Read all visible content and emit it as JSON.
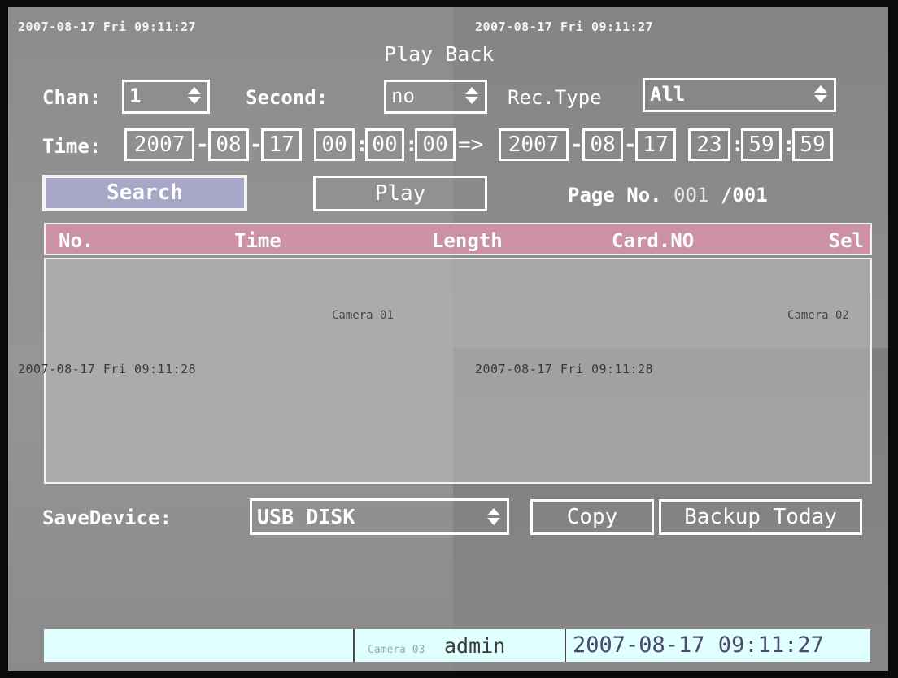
{
  "osd": {
    "ts_top_left": "2007-08-17 Fri 09:11:27",
    "ts_top_right": "2007-08-17 Fri 09:11:27",
    "ts_mid_left": "2007-08-17 Fri 09:11:28",
    "ts_mid_right": "2007-08-17 Fri 09:11:28",
    "camera_01": "Camera 01",
    "camera_02": "Camera 02",
    "camera_03": "Camera 03"
  },
  "title": "Play Back",
  "filters": {
    "chan_label": "Chan:",
    "chan_value": "1",
    "second_label": "Second:",
    "second_value": "no",
    "rectype_label": "Rec.Type",
    "rectype_value": "All"
  },
  "time": {
    "label": "Time:",
    "start": {
      "year": "2007",
      "month": "08",
      "day": "17",
      "hour": "00",
      "min": "00",
      "sec": "00"
    },
    "arrow": "=>",
    "end": {
      "year": "2007",
      "month": "08",
      "day": "17",
      "hour": "23",
      "min": "59",
      "sec": "59"
    }
  },
  "actions": {
    "search_label": "Search",
    "play_label": "Play",
    "page_label": "Page No.",
    "page_current": "001",
    "page_total": "/001"
  },
  "table": {
    "columns": [
      "No.",
      "Time",
      "Length",
      "Card.NO",
      "Sel"
    ],
    "rows": []
  },
  "save": {
    "label": "SaveDevice:",
    "device": "USB DISK",
    "copy_label": "Copy",
    "backup_label": "Backup Today"
  },
  "status": {
    "user": "admin",
    "datetime": "2007-08-17 09:11:27"
  },
  "colors": {
    "search_button_bg": "#a8a7c8",
    "table_header_bg": "#cc92a3",
    "status_bar_bg": "#e0ffff"
  }
}
